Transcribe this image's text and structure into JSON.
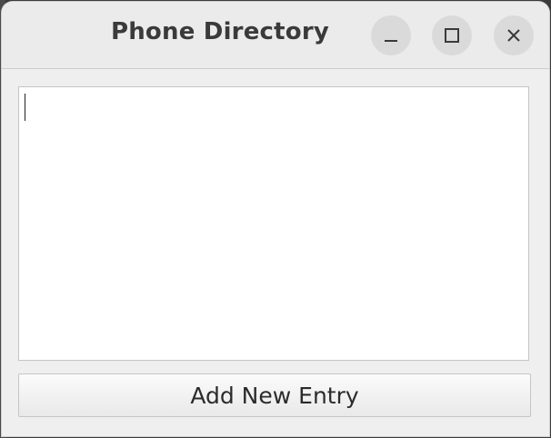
{
  "window": {
    "title": "Phone Directory",
    "controls": {
      "minimize_icon": "minimize-icon",
      "maximize_icon": "maximize-icon",
      "close_icon": "close-icon"
    }
  },
  "main": {
    "entry_text": "",
    "add_button_label": "Add New Entry"
  },
  "colors": {
    "window_bg": "#efefef",
    "titlebar_bg": "#ebebeb",
    "control_bg": "#dadada",
    "text_area_bg": "#ffffff"
  }
}
